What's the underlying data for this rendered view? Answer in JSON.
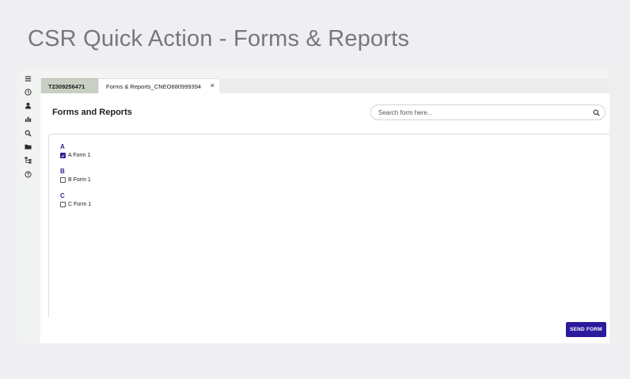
{
  "page_title": "CSR Quick Action - Forms & Reports",
  "rail": {
    "icons": [
      "menu-icon",
      "history-icon",
      "user-icon",
      "bar-chart-icon",
      "search-icon",
      "folder-icon",
      "hierarchy-icon",
      "help-icon"
    ]
  },
  "tabs": [
    {
      "label": "T2309256471",
      "active": false
    },
    {
      "label": "Forms & Reports_CNEO680999394",
      "active": true,
      "close": "×"
    }
  ],
  "main": {
    "title": "Forms and Reports",
    "search": {
      "placeholder": "Search form here...",
      "value": ""
    },
    "groups": [
      {
        "letter": "A",
        "items": [
          {
            "label": "A Form 1",
            "checked": true
          }
        ]
      },
      {
        "letter": "B",
        "items": [
          {
            "label": "B Form 1",
            "checked": false
          }
        ]
      },
      {
        "letter": "C",
        "items": [
          {
            "label": "C Form 1",
            "checked": false
          }
        ]
      }
    ],
    "send_button": "SEND FORM"
  },
  "colors": {
    "accent": "#2c1a9c",
    "group_letter": "#2a1f8f",
    "ticket_tab": "#c8d0c4"
  }
}
